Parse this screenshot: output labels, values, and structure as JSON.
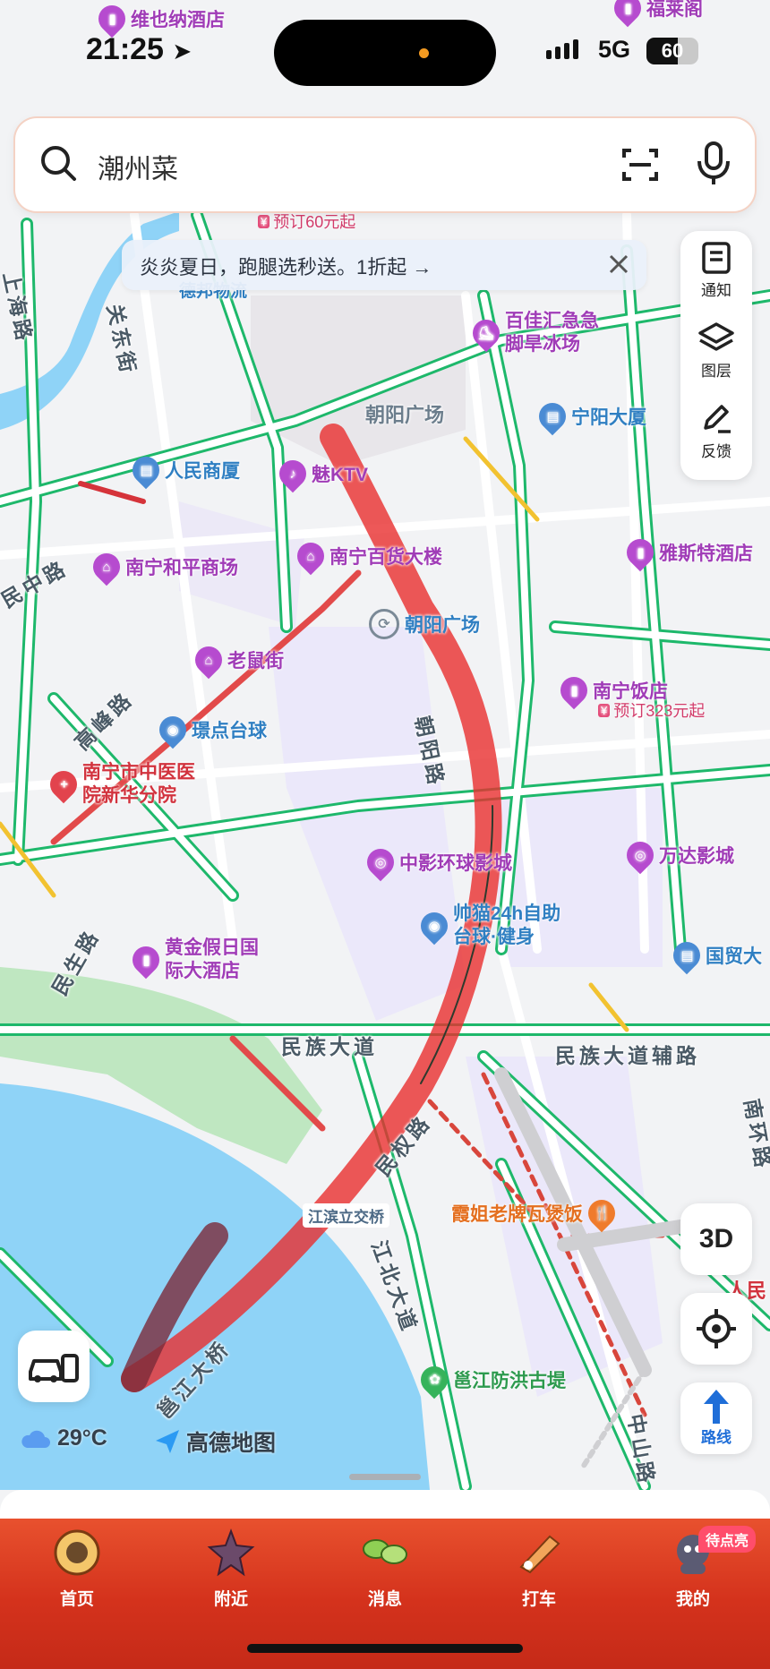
{
  "status_bar": {
    "time": "21:25",
    "network": "5G",
    "battery": "60"
  },
  "search": {
    "placeholder": "潮州菜"
  },
  "banner": {
    "text": "炎炎夏日，跑腿选秒送。1折起 →"
  },
  "tools": {
    "notify": "通知",
    "layers": "图层",
    "feedback": "反馈"
  },
  "controls": {
    "three_d": "3D",
    "route": "路线"
  },
  "weather": {
    "temperature": "29°C"
  },
  "brand": {
    "name": "高德地图"
  },
  "pois": {
    "vienna_hotel": "维也纳酒店",
    "fulaige": "福莱阁",
    "booking_60": "预订60元起",
    "debang": "德邦物流",
    "baijiahui_1": "百佳汇急急",
    "baijiahui_2": "脚旱冰场",
    "chaoyang_square_area": "朝阳广场",
    "ningyang_building": "宁阳大厦",
    "renmin_building": "人民商厦",
    "mei_ktv": "魅KTV",
    "nanning_heping": "南宁和平商场",
    "nanning_baihuo": "南宁百货大楼",
    "yasite_hotel": "雅斯特酒店",
    "chaoyang_square_station": "朝阳广场",
    "laoshujie": "老鼠街",
    "nanning_hotel": "南宁饭店",
    "booking_323": "预订323元起",
    "huandian_billiards": "璟点台球",
    "tcm_hospital_1": "南宁市中医医",
    "tcm_hospital_2": "院新华分院",
    "zhongying_cinema": "中影环球影城",
    "wanda_cinema": "万达影城",
    "shuaimao_1": "帅猫24h自助",
    "shuaimao_2": "台球·健身",
    "huangjin_hotel_1": "黄金假日国",
    "huangjin_hotel_2": "际大酒店",
    "guomao": "国贸大",
    "jiangbin_interchange": "江滨立交桥",
    "xiajie_restaurant": "霞姐老牌瓦煲饭",
    "yongjiang_dike": "邕江防洪古堤",
    "renmin_partial": "人民"
  },
  "roads": {
    "shanghai": "上海路",
    "guandong": "关东街",
    "minzhong": "民中路",
    "gaofeng": "高峰路",
    "minsheng": "民生路",
    "chaoyang": "朝阳路",
    "minzu": "民族大道",
    "minzu_aux": "民族大道辅路",
    "minquan": "民权路",
    "jiangbei": "江北大道",
    "yongjiang_bridge": "邕江大桥",
    "nanhuan": "南环路",
    "zhongshan": "中山路"
  },
  "tabs": [
    {
      "label": "首页"
    },
    {
      "label": "附近"
    },
    {
      "label": "消息"
    },
    {
      "label": "打车"
    },
    {
      "label": "我的"
    }
  ],
  "promo": {
    "tag": "待点亮"
  }
}
